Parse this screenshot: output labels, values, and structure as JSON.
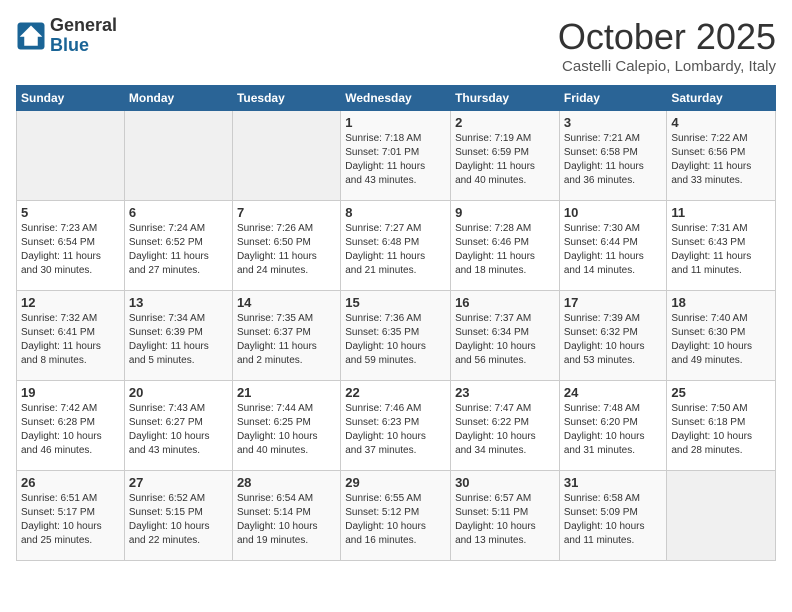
{
  "logo": {
    "general": "General",
    "blue": "Blue"
  },
  "title": "October 2025",
  "location": "Castelli Calepio, Lombardy, Italy",
  "days_header": [
    "Sunday",
    "Monday",
    "Tuesday",
    "Wednesday",
    "Thursday",
    "Friday",
    "Saturday"
  ],
  "weeks": [
    [
      {
        "day": "",
        "info": ""
      },
      {
        "day": "",
        "info": ""
      },
      {
        "day": "",
        "info": ""
      },
      {
        "day": "1",
        "info": "Sunrise: 7:18 AM\nSunset: 7:01 PM\nDaylight: 11 hours\nand 43 minutes."
      },
      {
        "day": "2",
        "info": "Sunrise: 7:19 AM\nSunset: 6:59 PM\nDaylight: 11 hours\nand 40 minutes."
      },
      {
        "day": "3",
        "info": "Sunrise: 7:21 AM\nSunset: 6:58 PM\nDaylight: 11 hours\nand 36 minutes."
      },
      {
        "day": "4",
        "info": "Sunrise: 7:22 AM\nSunset: 6:56 PM\nDaylight: 11 hours\nand 33 minutes."
      }
    ],
    [
      {
        "day": "5",
        "info": "Sunrise: 7:23 AM\nSunset: 6:54 PM\nDaylight: 11 hours\nand 30 minutes."
      },
      {
        "day": "6",
        "info": "Sunrise: 7:24 AM\nSunset: 6:52 PM\nDaylight: 11 hours\nand 27 minutes."
      },
      {
        "day": "7",
        "info": "Sunrise: 7:26 AM\nSunset: 6:50 PM\nDaylight: 11 hours\nand 24 minutes."
      },
      {
        "day": "8",
        "info": "Sunrise: 7:27 AM\nSunset: 6:48 PM\nDaylight: 11 hours\nand 21 minutes."
      },
      {
        "day": "9",
        "info": "Sunrise: 7:28 AM\nSunset: 6:46 PM\nDaylight: 11 hours\nand 18 minutes."
      },
      {
        "day": "10",
        "info": "Sunrise: 7:30 AM\nSunset: 6:44 PM\nDaylight: 11 hours\nand 14 minutes."
      },
      {
        "day": "11",
        "info": "Sunrise: 7:31 AM\nSunset: 6:43 PM\nDaylight: 11 hours\nand 11 minutes."
      }
    ],
    [
      {
        "day": "12",
        "info": "Sunrise: 7:32 AM\nSunset: 6:41 PM\nDaylight: 11 hours\nand 8 minutes."
      },
      {
        "day": "13",
        "info": "Sunrise: 7:34 AM\nSunset: 6:39 PM\nDaylight: 11 hours\nand 5 minutes."
      },
      {
        "day": "14",
        "info": "Sunrise: 7:35 AM\nSunset: 6:37 PM\nDaylight: 11 hours\nand 2 minutes."
      },
      {
        "day": "15",
        "info": "Sunrise: 7:36 AM\nSunset: 6:35 PM\nDaylight: 10 hours\nand 59 minutes."
      },
      {
        "day": "16",
        "info": "Sunrise: 7:37 AM\nSunset: 6:34 PM\nDaylight: 10 hours\nand 56 minutes."
      },
      {
        "day": "17",
        "info": "Sunrise: 7:39 AM\nSunset: 6:32 PM\nDaylight: 10 hours\nand 53 minutes."
      },
      {
        "day": "18",
        "info": "Sunrise: 7:40 AM\nSunset: 6:30 PM\nDaylight: 10 hours\nand 49 minutes."
      }
    ],
    [
      {
        "day": "19",
        "info": "Sunrise: 7:42 AM\nSunset: 6:28 PM\nDaylight: 10 hours\nand 46 minutes."
      },
      {
        "day": "20",
        "info": "Sunrise: 7:43 AM\nSunset: 6:27 PM\nDaylight: 10 hours\nand 43 minutes."
      },
      {
        "day": "21",
        "info": "Sunrise: 7:44 AM\nSunset: 6:25 PM\nDaylight: 10 hours\nand 40 minutes."
      },
      {
        "day": "22",
        "info": "Sunrise: 7:46 AM\nSunset: 6:23 PM\nDaylight: 10 hours\nand 37 minutes."
      },
      {
        "day": "23",
        "info": "Sunrise: 7:47 AM\nSunset: 6:22 PM\nDaylight: 10 hours\nand 34 minutes."
      },
      {
        "day": "24",
        "info": "Sunrise: 7:48 AM\nSunset: 6:20 PM\nDaylight: 10 hours\nand 31 minutes."
      },
      {
        "day": "25",
        "info": "Sunrise: 7:50 AM\nSunset: 6:18 PM\nDaylight: 10 hours\nand 28 minutes."
      }
    ],
    [
      {
        "day": "26",
        "info": "Sunrise: 6:51 AM\nSunset: 5:17 PM\nDaylight: 10 hours\nand 25 minutes."
      },
      {
        "day": "27",
        "info": "Sunrise: 6:52 AM\nSunset: 5:15 PM\nDaylight: 10 hours\nand 22 minutes."
      },
      {
        "day": "28",
        "info": "Sunrise: 6:54 AM\nSunset: 5:14 PM\nDaylight: 10 hours\nand 19 minutes."
      },
      {
        "day": "29",
        "info": "Sunrise: 6:55 AM\nSunset: 5:12 PM\nDaylight: 10 hours\nand 16 minutes."
      },
      {
        "day": "30",
        "info": "Sunrise: 6:57 AM\nSunset: 5:11 PM\nDaylight: 10 hours\nand 13 minutes."
      },
      {
        "day": "31",
        "info": "Sunrise: 6:58 AM\nSunset: 5:09 PM\nDaylight: 10 hours\nand 11 minutes."
      },
      {
        "day": "",
        "info": ""
      }
    ]
  ]
}
